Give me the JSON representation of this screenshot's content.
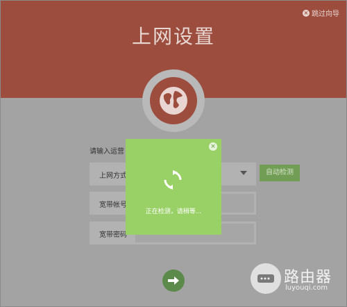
{
  "header": {
    "title": "上网设置",
    "skip_label": "跳过向导",
    "close_glyph": "×"
  },
  "form": {
    "prompt": "请输入运营",
    "connection_type_label": "上网方式",
    "account_label": "宽带帐号",
    "password_label": "宽带密码",
    "auto_detect_label": "自动检测"
  },
  "modal": {
    "status_text": "正在检测，请稍等...",
    "close_glyph": "×",
    "icon": "refresh-icon"
  },
  "watermark": {
    "name": "路由器",
    "domain": "luyouqi.com",
    "icon": "router-icon"
  },
  "colors": {
    "header_bg": "#9c4d3e",
    "modal_bg": "#99d166",
    "accent_green": "#5c8a4b"
  }
}
